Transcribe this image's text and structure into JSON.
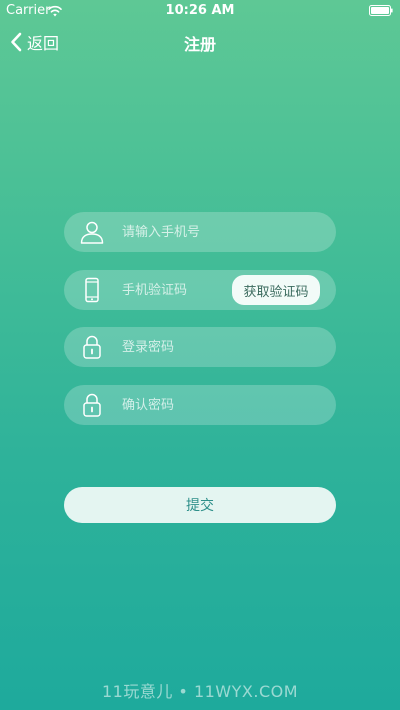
{
  "status_bar": {
    "carrier": "Carrier",
    "time": "10:26 AM"
  },
  "nav": {
    "back_label": "返回",
    "title": "注册"
  },
  "form": {
    "phone_placeholder": "请输入手机号",
    "code_placeholder": "手机验证码",
    "get_code_label": "获取验证码",
    "password_placeholder": "登录密码",
    "confirm_placeholder": "确认密码",
    "submit_label": "提交"
  },
  "watermark": "11玩意儿 • 11WYX.COM",
  "icons": {
    "wifi": "wifi-icon",
    "battery": "battery-icon",
    "back": "chevron-left-icon",
    "user": "user-icon",
    "phone": "phone-icon",
    "lock": "lock-icon"
  },
  "colors": {
    "gradient_top": "#5ec895",
    "gradient_bottom": "#1eaa9c",
    "button_bg": "#e4f5f1",
    "button_text": "#2d8f8a"
  }
}
